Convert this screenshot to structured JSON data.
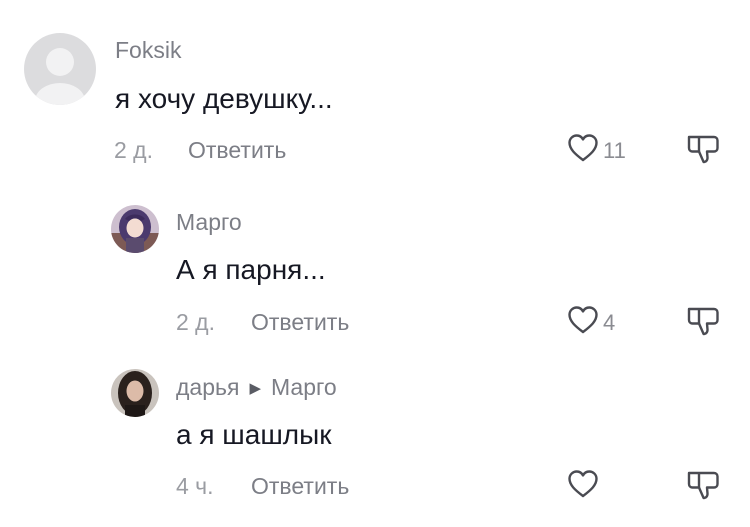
{
  "comments": [
    {
      "username": "Foksik",
      "text": "я хочу девушку...",
      "time": "2 д.",
      "reply_label": "Ответить",
      "likes": "11"
    },
    {
      "username": "Марго",
      "text": "А я парня...",
      "time": "2 д.",
      "reply_label": "Ответить",
      "likes": "4"
    },
    {
      "username": "дарья",
      "reply_to": "Марго",
      "text": "а я шашлык",
      "time": "4 ч.",
      "reply_label": "Ответить",
      "likes": ""
    }
  ],
  "icons": {
    "like": "heart-outline-icon",
    "dislike": "thumbs-down-icon",
    "reply_arrow": "triangle-right-icon"
  }
}
